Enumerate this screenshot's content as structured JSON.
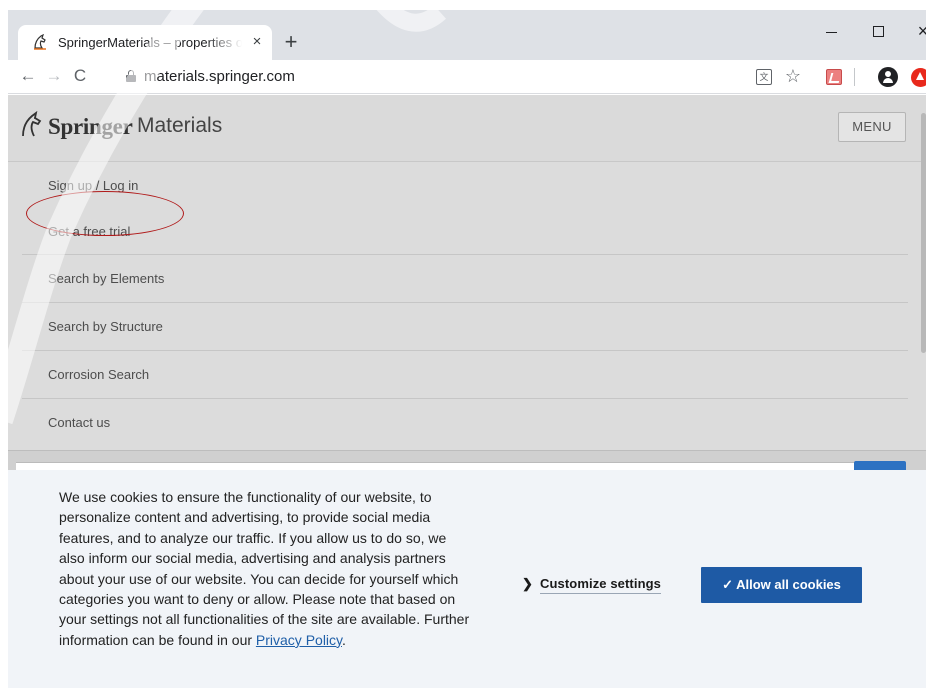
{
  "browser": {
    "tab_title": "SpringerMaterials – properties of materials",
    "tab_close": "×",
    "new_tab": "+",
    "window_close": "×",
    "url": "materials.springer.com",
    "back": "←",
    "forward": "→",
    "reload": "C",
    "translate": "文",
    "star": "☆"
  },
  "site": {
    "logo_word1": "Springer",
    "logo_word2": "Materials",
    "menu_label": "MENU",
    "nav": [
      {
        "label": "Sign up / Log in"
      },
      {
        "label": "Get a free trial"
      },
      {
        "label": "Search by Elements"
      },
      {
        "label": "Search by Structure"
      },
      {
        "label": "Corrosion Search"
      },
      {
        "label": "Contact us"
      }
    ]
  },
  "cookie": {
    "text": "We use cookies to ensure the functionality of our website, to personalize content and advertising, to provide social media features, and to analyze our traffic. If you allow us to do so, we also inform our social media, advertising and analysis partners about your use of our website. You can decide for yourself which categories you want to deny or allow. Please note that based on your settings not all functionalities of the site are available. Further information can be found in our ",
    "privacy_link": "Privacy Policy",
    "period": ".",
    "customize_chevron": "❯",
    "customize_label": "Customize settings",
    "allow_label": "✓ Allow all cookies"
  },
  "colors": {
    "accent_blue": "#1e5aa5",
    "annotation_circle": "#b01a1a",
    "logo_orange": "#e8731d"
  }
}
